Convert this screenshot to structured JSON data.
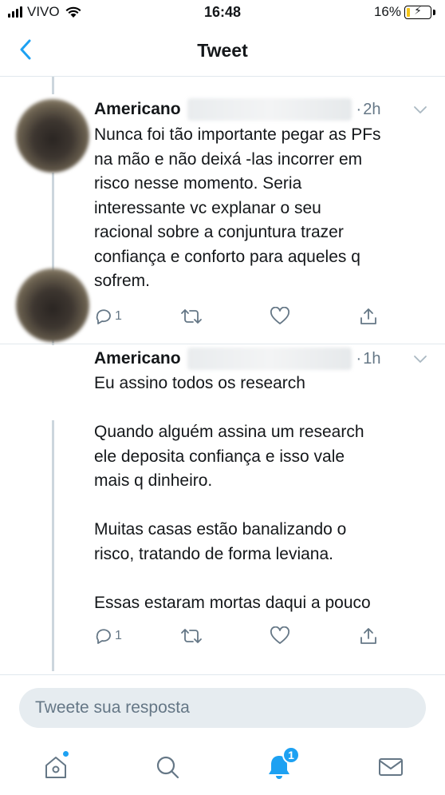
{
  "status_bar": {
    "carrier": "VIVO",
    "time": "16:48",
    "battery": "16%",
    "battery_level": 0.16
  },
  "header": {
    "title": "Tweet"
  },
  "tweets": [
    {
      "author": "Americano",
      "time": "2h",
      "text": "Nunca foi tão importante pegar as PFs\nna mão e não deixá -las incorrer em\nrisco nesse momento. Seria\ninteressante vc explanar o seu\nracional sobre a conjuntura trazer\nconfiança e conforto para aqueles q\nsofrem.",
      "reply_count": "1"
    },
    {
      "author": "Americano",
      "time": "1h",
      "text": "Eu assino todos os research\n\nQuando alguém assina um research\nele deposita confiança e isso vale\nmais q dinheiro.\n\nMuitas casas estão banalizando o\nrisco, tratando de forma leviana.\n\nEssas estaram mortas daqui a pouco",
      "reply_count": "1"
    }
  ],
  "reply": {
    "placeholder": "Tweete sua resposta"
  },
  "tab_bar": {
    "notifications_badge": "1",
    "icons": [
      "home-icon",
      "search-icon",
      "notifications-icon",
      "messages-icon"
    ]
  },
  "colors": {
    "accent": "#1da1f2",
    "secondary_text": "#657786",
    "divider": "#e1e8ed",
    "input_bg": "#e6ecf0"
  }
}
